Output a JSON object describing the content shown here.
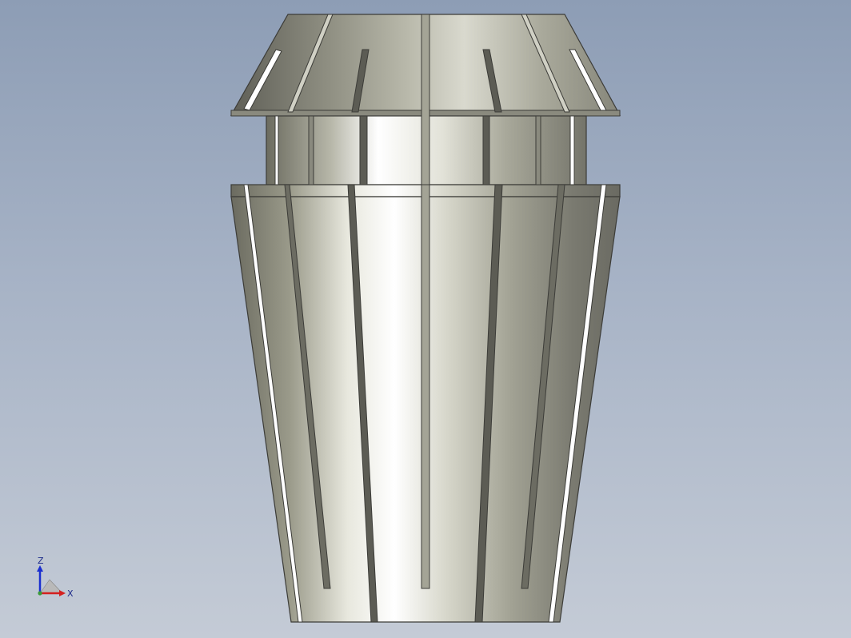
{
  "viewport": {
    "model": "collet"
  },
  "triad": {
    "z_label": "Z",
    "x_label": "X",
    "z_color": "#1a2fd0",
    "x_color": "#d42020",
    "y_color": "#3a9a3a",
    "icon": "coordinate-triad-icon"
  },
  "colors": {
    "background_top": "#8d9db5",
    "background_bottom": "#c4cbd6",
    "metal_dark": "#6c6c62",
    "metal_light": "#ffffff",
    "outline": "#3c3c38"
  }
}
